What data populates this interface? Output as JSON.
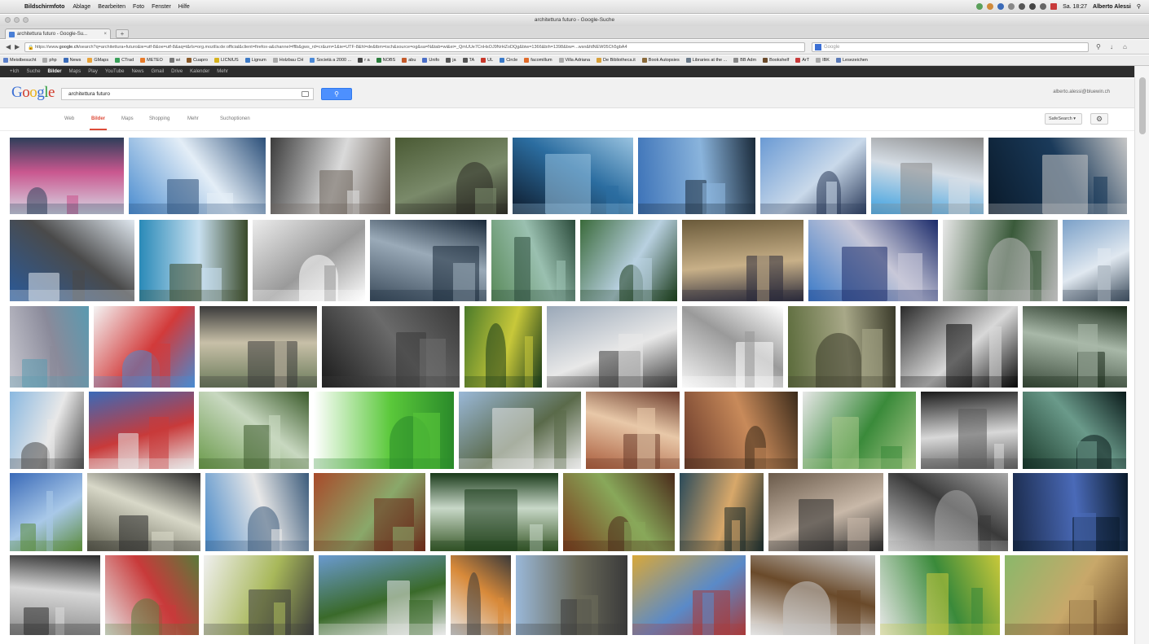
{
  "menubar": {
    "app_name": "Bildschirmfoto",
    "items": [
      "Ablage",
      "Bearbeiten",
      "Foto",
      "Fenster",
      "Hilfe"
    ],
    "clock": "Sa. 18:27",
    "user": "Alberto Alessi"
  },
  "window": {
    "title": "architettura futuro - Google-Suche"
  },
  "tab": {
    "label": "architettura futuro - Google-Su...",
    "new_tab": "+"
  },
  "nav": {
    "url_prefix": "https://www.",
    "url_domain": "google.ch",
    "url_rest": "/search?q=architettura+futuro&ie=utf-8&oe=utf-8&aq=t&rls=org.mozilla:de:official&client=firefox-a&channel=fflb&gws_rd=cr&um=1&ie=UTF-8&hl=de&tbm=isch&source=og&sa=N&tab=wi&ei=_QmUUe7CnHsOJ9NrHZoDQg&biw=1366&bih=1398&bw=...wsn&fdNEW05Ch5gbA4",
    "search_placeholder": "Google"
  },
  "bookmarks": [
    {
      "label": "Meistbesucht",
      "color": "#5b7fc9"
    },
    {
      "label": "php",
      "color": "#aaaaaa"
    },
    {
      "label": "News",
      "color": "#3a6bb8"
    },
    {
      "label": "GMaps",
      "color": "#e8a33a"
    },
    {
      "label": "CTrad",
      "color": "#3aa05a"
    },
    {
      "label": "METEO",
      "color": "#e87b2a"
    },
    {
      "label": "wi",
      "color": "#777777"
    },
    {
      "label": "Cuapro",
      "color": "#8a5a2a"
    },
    {
      "label": "LICNIUS",
      "color": "#d6b21e"
    },
    {
      "label": "Lignum",
      "color": "#3d7ac6"
    },
    {
      "label": "Holzbau CH",
      "color": "#aaaaaa"
    },
    {
      "label": "Società a 2000 ...",
      "color": "#4b8ad8"
    },
    {
      "label": "r a",
      "color": "#444444"
    },
    {
      "label": "NOBS",
      "color": "#2a7d3c"
    },
    {
      "label": "abu",
      "color": "#c45a2a"
    },
    {
      "label": "Unifo",
      "color": "#4a6ec7"
    },
    {
      "label": "ja",
      "color": "#555555"
    },
    {
      "label": "TA",
      "color": "#555555"
    },
    {
      "label": "UL",
      "color": "#c8372a"
    },
    {
      "label": "Circle",
      "color": "#3a7ac9"
    },
    {
      "label": "facomillum",
      "color": "#e06b2a"
    },
    {
      "label": "Villa Adriana",
      "color": "#aaaaaa"
    },
    {
      "label": "De Bibliotheca.it",
      "color": "#d8a03a"
    },
    {
      "label": "Book Autopsies",
      "color": "#8a6a3a"
    },
    {
      "label": "Libraries at the ...",
      "color": "#6a7a8a"
    },
    {
      "label": "BB Adm",
      "color": "#888888"
    },
    {
      "label": "Bookshelf",
      "color": "#6a4a2a"
    },
    {
      "label": "ArT",
      "color": "#c83a3a"
    },
    {
      "label": "IBK",
      "color": "#aaaaaa"
    },
    {
      "label": "Lesezeichen",
      "color": "#5a7ab8"
    }
  ],
  "google_bar": {
    "items": [
      "+Ich",
      "Suche",
      "Bilder",
      "Maps",
      "Play",
      "YouTube",
      "News",
      "Gmail",
      "Drive",
      "Kalender",
      "Mehr"
    ]
  },
  "google_header": {
    "logo": "Google",
    "query": "architettura futuro",
    "account": "alberto.alessi@bluewin.ch"
  },
  "search_tabs": {
    "items": [
      "Web",
      "Bilder",
      "Maps",
      "Shopping",
      "Mehr",
      "Suchoptionen"
    ],
    "safesearch": "SafeSearch"
  },
  "images": {
    "rows": [
      [
        {
          "w": 140,
          "c": [
            "#d7d7e4",
            "#c9578f",
            "#2e3e5a"
          ]
        },
        {
          "w": 168,
          "c": [
            "#4a8ccf",
            "#e4eef7",
            "#2b4f79"
          ]
        },
        {
          "w": 147,
          "c": [
            "#3c3c3c",
            "#dadada",
            "#6a6058"
          ]
        },
        {
          "w": 138,
          "c": [
            "#4a5a34",
            "#7a8a6a",
            "#2c2c24"
          ]
        },
        {
          "w": 148,
          "c": [
            "#0e1a2a",
            "#2b6da0",
            "#99c3e0"
          ]
        },
        {
          "w": 144,
          "c": [
            "#3d73b8",
            "#8ab4dc",
            "#1a2a3a"
          ]
        },
        {
          "w": 130,
          "c": [
            "#6a9ad4",
            "#c9d9ea",
            "#2a3a5a"
          ]
        },
        {
          "w": 138,
          "c": [
            "#3aa0e0",
            "#d6dee6",
            "#888888"
          ]
        },
        {
          "w": 170,
          "c": [
            "#0a1a2a",
            "#1a3a5a",
            "#c8c8c8"
          ]
        }
      ],
      [
        {
          "w": 152,
          "c": [
            "#2a5a9a",
            "#4a4a4a",
            "#e0e8f0"
          ]
        },
        {
          "w": 132,
          "c": [
            "#2a8ab8",
            "#c8e0f0",
            "#3a4a2a"
          ]
        },
        {
          "w": 137,
          "c": [
            "#ececec",
            "#9a9a9a",
            "#ffffff"
          ]
        },
        {
          "w": 142,
          "c": [
            "#3a4a5a",
            "#9aaab8",
            "#1a2a3a"
          ]
        },
        {
          "w": 102,
          "c": [
            "#5a8a5a",
            "#9ac0b0",
            "#2a4a3a"
          ]
        },
        {
          "w": 118,
          "c": [
            "#3a6a3a",
            "#b8d0e0",
            "#1a3a1a"
          ]
        },
        {
          "w": 148,
          "c": [
            "#6a5a3a",
            "#c8b088",
            "#2a2a3a"
          ]
        },
        {
          "w": 158,
          "c": [
            "#3a7ac8",
            "#c8c8d8",
            "#1a2a6a"
          ]
        },
        {
          "w": 140,
          "c": [
            "#e8e8e8",
            "#3a5a3a",
            "#b8b8b8"
          ]
        },
        {
          "w": 82,
          "c": [
            "#7aa0c8",
            "#e0e8f0",
            "#3a4a5a"
          ]
        }
      ],
      [
        {
          "w": 96,
          "c": [
            "#c8c8d0",
            "#8a8a9a",
            "#5a9ab0"
          ]
        },
        {
          "w": 122,
          "c": [
            "#f4f4f4",
            "#d23a3a",
            "#4a8ad0"
          ]
        },
        {
          "w": 142,
          "c": [
            "#6a7a5a",
            "#c8c0a8",
            "#3a3a3a"
          ]
        },
        {
          "w": 166,
          "c": [
            "#1a1a1a",
            "#6a6a6a",
            "#3a3a3a"
          ]
        },
        {
          "w": 94,
          "c": [
            "#4a7a2a",
            "#c8c83a",
            "#1a3a1a"
          ]
        },
        {
          "w": 158,
          "c": [
            "#9aa8b8",
            "#e8e8e8",
            "#3a3a3a"
          ]
        },
        {
          "w": 122,
          "c": [
            "#f6f6f6",
            "#9a9a9a",
            "#ffffff"
          ]
        },
        {
          "w": 130,
          "c": [
            "#5a6a3a",
            "#a8a888",
            "#3a3a2a"
          ]
        },
        {
          "w": 142,
          "c": [
            "#2a2a2a",
            "#d8d8d8",
            "#0a0a0a"
          ]
        },
        {
          "w": 126,
          "c": [
            "#3a4a3a",
            "#a8b8a8",
            "#1a2a1a"
          ]
        }
      ],
      [
        {
          "w": 90,
          "c": [
            "#8ab8e0",
            "#e8e8e8",
            "#4a4a4a"
          ]
        },
        {
          "w": 128,
          "c": [
            "#3a6ab8",
            "#c83a3a",
            "#e8e8e8"
          ]
        },
        {
          "w": 134,
          "c": [
            "#6a9a4a",
            "#c8d8c0",
            "#3a5a2a"
          ]
        },
        {
          "w": 170,
          "c": [
            "#ffffff",
            "#5ac83a",
            "#2a8a2a"
          ]
        },
        {
          "w": 148,
          "c": [
            "#9ab8d8",
            "#5a6a4a",
            "#e8e8e8"
          ]
        },
        {
          "w": 114,
          "c": [
            "#a85a3a",
            "#e8c8a8",
            "#6a3a2a"
          ]
        },
        {
          "w": 138,
          "c": [
            "#6a3a2a",
            "#c88a5a",
            "#3a2a1a"
          ]
        },
        {
          "w": 138,
          "c": [
            "#e8e8e8",
            "#3a8a3a",
            "#a8c888"
          ]
        },
        {
          "w": 118,
          "c": [
            "#1a1a1a",
            "#d8d8d8",
            "#5a5a5a"
          ]
        },
        {
          "w": 126,
          "c": [
            "#1a3a2a",
            "#6a9a8a",
            "#0a1a1a"
          ]
        }
      ],
      [
        {
          "w": 88,
          "c": [
            "#3a6ab8",
            "#a8c8e8",
            "#5a8a3a"
          ]
        },
        {
          "w": 138,
          "c": [
            "#5a5a4a",
            "#d8d8c8",
            "#2a2a2a"
          ]
        },
        {
          "w": 126,
          "c": [
            "#4a8ac8",
            "#e8e8e8",
            "#3a5a7a"
          ]
        },
        {
          "w": 136,
          "c": [
            "#a84a2a",
            "#8aa86a",
            "#6a2a1a"
          ]
        },
        {
          "w": 156,
          "c": [
            "#3a5a2a",
            "#c8d8c8",
            "#1a3a1a"
          ]
        },
        {
          "w": 136,
          "c": [
            "#7a3a1a",
            "#88a85a",
            "#4a2a1a"
          ]
        },
        {
          "w": 102,
          "c": [
            "#2a4a5a",
            "#d8a86a",
            "#1a2a2a"
          ]
        },
        {
          "w": 140,
          "c": [
            "#6a5a4a",
            "#c8b8a8",
            "#2a2a2a"
          ]
        },
        {
          "w": 146,
          "c": [
            "#d8d8d8",
            "#3a3a3a",
            "#a8a8a8"
          ]
        },
        {
          "w": 140,
          "c": [
            "#1a2a4a",
            "#4a6ab8",
            "#0a1a2a"
          ]
        }
      ],
      [
        {
          "w": 108,
          "c": [
            "#8a8a8a",
            "#d8d8d8",
            "#2a2a2a"
          ]
        },
        {
          "w": 112,
          "c": [
            "#e8e8e8",
            "#c83a3a",
            "#5a7a3a"
          ]
        },
        {
          "w": 132,
          "c": [
            "#f0f0f0",
            "#a8b85a",
            "#3a3a3a"
          ]
        },
        {
          "w": 152,
          "c": [
            "#6a9ad0",
            "#3a6a2a",
            "#e8e8e8"
          ]
        },
        {
          "w": 72,
          "c": [
            "#e8e8e8",
            "#d88a3a",
            "#3a3a3a"
          ]
        },
        {
          "w": 134,
          "c": [
            "#9ab8d8",
            "#6a6a5a",
            "#3a3a3a"
          ]
        },
        {
          "w": 136,
          "c": [
            "#d8a83a",
            "#5a8ac8",
            "#a83a3a"
          ]
        },
        {
          "w": 150,
          "c": [
            "#f0f0f0",
            "#6a4a2a",
            "#c8c8c8"
          ]
        },
        {
          "w": 144,
          "c": [
            "#e8e8e8",
            "#3a8a3a",
            "#c8c83a"
          ]
        },
        {
          "w": 148,
          "c": [
            "#8ab86a",
            "#c8a86a",
            "#6a4a2a"
          ]
        }
      ]
    ]
  }
}
